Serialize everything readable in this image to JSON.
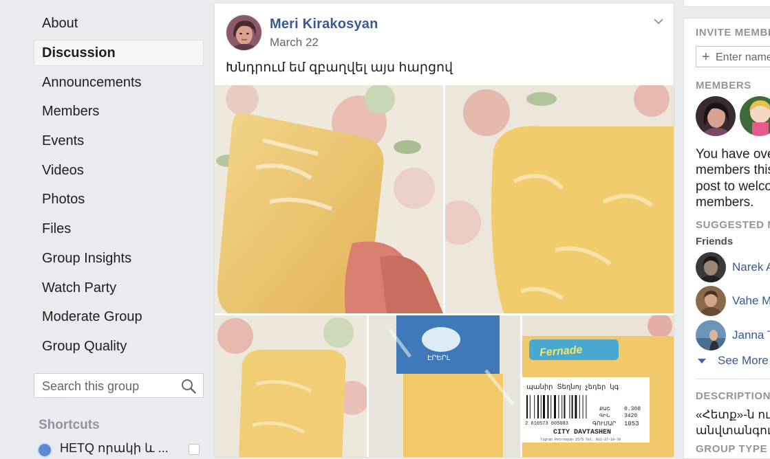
{
  "nav": {
    "items": [
      {
        "label": "About"
      },
      {
        "label": "Discussion",
        "active": true
      },
      {
        "label": "Announcements"
      },
      {
        "label": "Members"
      },
      {
        "label": "Events"
      },
      {
        "label": "Videos"
      },
      {
        "label": "Photos"
      },
      {
        "label": "Files"
      },
      {
        "label": "Group Insights"
      },
      {
        "label": "Watch Party"
      },
      {
        "label": "Moderate Group"
      },
      {
        "label": "Group Quality"
      }
    ],
    "search_placeholder": "Search this group",
    "search_icon": "search-icon"
  },
  "shortcuts": {
    "heading": "Shortcuts",
    "items": [
      {
        "label": "HETQ որակի և ..."
      }
    ]
  },
  "post": {
    "author": "Meri Kirakosyan",
    "date": "March 22",
    "text": "Խնդրում եմ զբաղվել այս հարցով",
    "menu_icon": "chevron-down-icon",
    "photo_count": 5,
    "label": {
      "brand": "Fernade",
      "header": "պանիր Տեղնոյ չեդեր կգ",
      "store": "CITY DAVTASHEN",
      "weight_label": "ՔԱՇ",
      "weight": "0.308",
      "price_label": "ԳԻՆ",
      "price": "3420",
      "total_label": "ԳՈՒՄԱՐ",
      "total": "1053",
      "barcode": "2 610573 005083",
      "footer": "Tigran Petrosyan 25/5 Tel. 011-37-19-70"
    }
  },
  "right": {
    "invite_heading": "INVITE MEMBERS",
    "invite_placeholder": "Enter name or email",
    "members_heading": "MEMBERS",
    "welcome_text": [
      "You have over",
      "members this",
      "post to welcom",
      "members."
    ],
    "suggested_heading": "SUGGESTED MEMBERS",
    "friends_label": "Friends",
    "friends": [
      {
        "name": "Narek A"
      },
      {
        "name": "Vahe Ma"
      },
      {
        "name": "Janna T"
      }
    ],
    "see_more": "See More",
    "description_heading": "DESCRIPTION",
    "description_lines": [
      "«Հետք»-ն ուս",
      "անվտանգութ"
    ],
    "group_type_heading": "GROUP TYPE"
  }
}
